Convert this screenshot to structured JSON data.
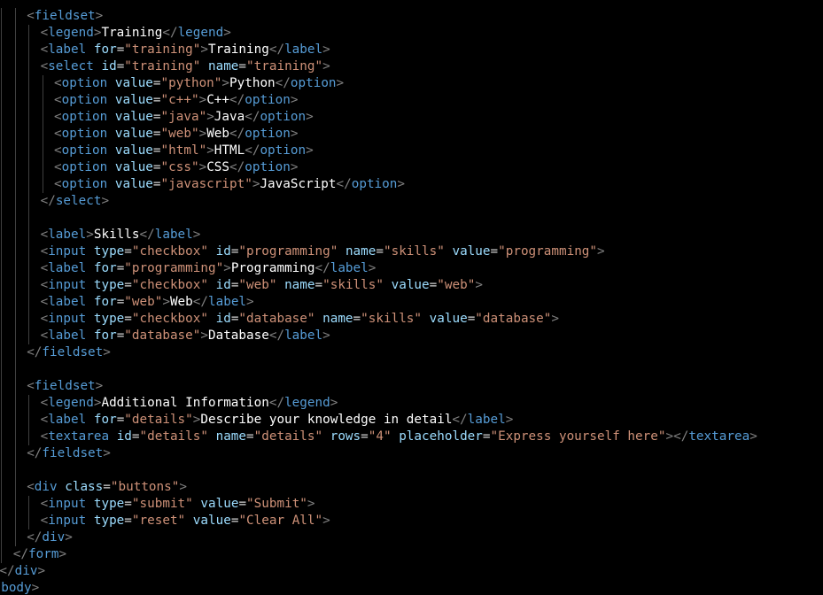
{
  "theme": {
    "background": "#000000",
    "bracket": "#808080",
    "tag": "#569cd6",
    "attribute": "#9cdcfe",
    "string": "#ce9178",
    "text": "#ffffff",
    "indent_guide": "#404040"
  },
  "lines": [
    {
      "indent": 6,
      "tokens": [
        [
          "b",
          "<"
        ],
        [
          "t",
          "fieldset"
        ],
        [
          "b",
          ">"
        ]
      ]
    },
    {
      "indent": 8,
      "tokens": [
        [
          "b",
          "<"
        ],
        [
          "t",
          "legend"
        ],
        [
          "b",
          ">"
        ],
        [
          "x",
          "Training"
        ],
        [
          "b",
          "</"
        ],
        [
          "t",
          "legend"
        ],
        [
          "b",
          ">"
        ]
      ]
    },
    {
      "indent": 8,
      "tokens": [
        [
          "b",
          "<"
        ],
        [
          "t",
          "label"
        ],
        [
          "x",
          " "
        ],
        [
          "a",
          "for"
        ],
        [
          "e",
          "="
        ],
        [
          "s",
          "\"training\""
        ],
        [
          "b",
          ">"
        ],
        [
          "x",
          "Training"
        ],
        [
          "b",
          "</"
        ],
        [
          "t",
          "label"
        ],
        [
          "b",
          ">"
        ]
      ]
    },
    {
      "indent": 8,
      "tokens": [
        [
          "b",
          "<"
        ],
        [
          "t",
          "select"
        ],
        [
          "x",
          " "
        ],
        [
          "a",
          "id"
        ],
        [
          "e",
          "="
        ],
        [
          "s",
          "\"training\""
        ],
        [
          "x",
          " "
        ],
        [
          "a",
          "name"
        ],
        [
          "e",
          "="
        ],
        [
          "s",
          "\"training\""
        ],
        [
          "b",
          ">"
        ]
      ]
    },
    {
      "indent": 10,
      "tokens": [
        [
          "b",
          "<"
        ],
        [
          "t",
          "option"
        ],
        [
          "x",
          " "
        ],
        [
          "a",
          "value"
        ],
        [
          "e",
          "="
        ],
        [
          "s",
          "\"python\""
        ],
        [
          "b",
          ">"
        ],
        [
          "x",
          "Python"
        ],
        [
          "b",
          "</"
        ],
        [
          "t",
          "option"
        ],
        [
          "b",
          ">"
        ]
      ]
    },
    {
      "indent": 10,
      "tokens": [
        [
          "b",
          "<"
        ],
        [
          "t",
          "option"
        ],
        [
          "x",
          " "
        ],
        [
          "a",
          "value"
        ],
        [
          "e",
          "="
        ],
        [
          "s",
          "\"c++\""
        ],
        [
          "b",
          ">"
        ],
        [
          "x",
          "C++"
        ],
        [
          "b",
          "</"
        ],
        [
          "t",
          "option"
        ],
        [
          "b",
          ">"
        ]
      ]
    },
    {
      "indent": 10,
      "tokens": [
        [
          "b",
          "<"
        ],
        [
          "t",
          "option"
        ],
        [
          "x",
          " "
        ],
        [
          "a",
          "value"
        ],
        [
          "e",
          "="
        ],
        [
          "s",
          "\"java\""
        ],
        [
          "b",
          ">"
        ],
        [
          "x",
          "Java"
        ],
        [
          "b",
          "</"
        ],
        [
          "t",
          "option"
        ],
        [
          "b",
          ">"
        ]
      ]
    },
    {
      "indent": 10,
      "tokens": [
        [
          "b",
          "<"
        ],
        [
          "t",
          "option"
        ],
        [
          "x",
          " "
        ],
        [
          "a",
          "value"
        ],
        [
          "e",
          "="
        ],
        [
          "s",
          "\"web\""
        ],
        [
          "b",
          ">"
        ],
        [
          "x",
          "Web"
        ],
        [
          "b",
          "</"
        ],
        [
          "t",
          "option"
        ],
        [
          "b",
          ">"
        ]
      ]
    },
    {
      "indent": 10,
      "tokens": [
        [
          "b",
          "<"
        ],
        [
          "t",
          "option"
        ],
        [
          "x",
          " "
        ],
        [
          "a",
          "value"
        ],
        [
          "e",
          "="
        ],
        [
          "s",
          "\"html\""
        ],
        [
          "b",
          ">"
        ],
        [
          "x",
          "HTML"
        ],
        [
          "b",
          "</"
        ],
        [
          "t",
          "option"
        ],
        [
          "b",
          ">"
        ]
      ]
    },
    {
      "indent": 10,
      "tokens": [
        [
          "b",
          "<"
        ],
        [
          "t",
          "option"
        ],
        [
          "x",
          " "
        ],
        [
          "a",
          "value"
        ],
        [
          "e",
          "="
        ],
        [
          "s",
          "\"css\""
        ],
        [
          "b",
          ">"
        ],
        [
          "x",
          "CSS"
        ],
        [
          "b",
          "</"
        ],
        [
          "t",
          "option"
        ],
        [
          "b",
          ">"
        ]
      ]
    },
    {
      "indent": 10,
      "tokens": [
        [
          "b",
          "<"
        ],
        [
          "t",
          "option"
        ],
        [
          "x",
          " "
        ],
        [
          "a",
          "value"
        ],
        [
          "e",
          "="
        ],
        [
          "s",
          "\"javascript\""
        ],
        [
          "b",
          ">"
        ],
        [
          "x",
          "JavaScript"
        ],
        [
          "b",
          "</"
        ],
        [
          "t",
          "option"
        ],
        [
          "b",
          ">"
        ]
      ]
    },
    {
      "indent": 8,
      "tokens": [
        [
          "b",
          "</"
        ],
        [
          "t",
          "select"
        ],
        [
          "b",
          ">"
        ]
      ]
    },
    {
      "indent": 0,
      "tokens": []
    },
    {
      "indent": 8,
      "tokens": [
        [
          "b",
          "<"
        ],
        [
          "t",
          "label"
        ],
        [
          "b",
          ">"
        ],
        [
          "x",
          "Skills"
        ],
        [
          "b",
          "</"
        ],
        [
          "t",
          "label"
        ],
        [
          "b",
          ">"
        ]
      ]
    },
    {
      "indent": 8,
      "tokens": [
        [
          "b",
          "<"
        ],
        [
          "t",
          "input"
        ],
        [
          "x",
          " "
        ],
        [
          "a",
          "type"
        ],
        [
          "e",
          "="
        ],
        [
          "s",
          "\"checkbox\""
        ],
        [
          "x",
          " "
        ],
        [
          "a",
          "id"
        ],
        [
          "e",
          "="
        ],
        [
          "s",
          "\"programming\""
        ],
        [
          "x",
          " "
        ],
        [
          "a",
          "name"
        ],
        [
          "e",
          "="
        ],
        [
          "s",
          "\"skills\""
        ],
        [
          "x",
          " "
        ],
        [
          "a",
          "value"
        ],
        [
          "e",
          "="
        ],
        [
          "s",
          "\"programming\""
        ],
        [
          "b",
          ">"
        ]
      ]
    },
    {
      "indent": 8,
      "tokens": [
        [
          "b",
          "<"
        ],
        [
          "t",
          "label"
        ],
        [
          "x",
          " "
        ],
        [
          "a",
          "for"
        ],
        [
          "e",
          "="
        ],
        [
          "s",
          "\"programming\""
        ],
        [
          "b",
          ">"
        ],
        [
          "x",
          "Programming"
        ],
        [
          "b",
          "</"
        ],
        [
          "t",
          "label"
        ],
        [
          "b",
          ">"
        ]
      ]
    },
    {
      "indent": 8,
      "tokens": [
        [
          "b",
          "<"
        ],
        [
          "t",
          "input"
        ],
        [
          "x",
          " "
        ],
        [
          "a",
          "type"
        ],
        [
          "e",
          "="
        ],
        [
          "s",
          "\"checkbox\""
        ],
        [
          "x",
          " "
        ],
        [
          "a",
          "id"
        ],
        [
          "e",
          "="
        ],
        [
          "s",
          "\"web\""
        ],
        [
          "x",
          " "
        ],
        [
          "a",
          "name"
        ],
        [
          "e",
          "="
        ],
        [
          "s",
          "\"skills\""
        ],
        [
          "x",
          " "
        ],
        [
          "a",
          "value"
        ],
        [
          "e",
          "="
        ],
        [
          "s",
          "\"web\""
        ],
        [
          "b",
          ">"
        ]
      ]
    },
    {
      "indent": 8,
      "tokens": [
        [
          "b",
          "<"
        ],
        [
          "t",
          "label"
        ],
        [
          "x",
          " "
        ],
        [
          "a",
          "for"
        ],
        [
          "e",
          "="
        ],
        [
          "s",
          "\"web\""
        ],
        [
          "b",
          ">"
        ],
        [
          "x",
          "Web"
        ],
        [
          "b",
          "</"
        ],
        [
          "t",
          "label"
        ],
        [
          "b",
          ">"
        ]
      ]
    },
    {
      "indent": 8,
      "tokens": [
        [
          "b",
          "<"
        ],
        [
          "t",
          "input"
        ],
        [
          "x",
          " "
        ],
        [
          "a",
          "type"
        ],
        [
          "e",
          "="
        ],
        [
          "s",
          "\"checkbox\""
        ],
        [
          "x",
          " "
        ],
        [
          "a",
          "id"
        ],
        [
          "e",
          "="
        ],
        [
          "s",
          "\"database\""
        ],
        [
          "x",
          " "
        ],
        [
          "a",
          "name"
        ],
        [
          "e",
          "="
        ],
        [
          "s",
          "\"skills\""
        ],
        [
          "x",
          " "
        ],
        [
          "a",
          "value"
        ],
        [
          "e",
          "="
        ],
        [
          "s",
          "\"database\""
        ],
        [
          "b",
          ">"
        ]
      ]
    },
    {
      "indent": 8,
      "tokens": [
        [
          "b",
          "<"
        ],
        [
          "t",
          "label"
        ],
        [
          "x",
          " "
        ],
        [
          "a",
          "for"
        ],
        [
          "e",
          "="
        ],
        [
          "s",
          "\"database\""
        ],
        [
          "b",
          ">"
        ],
        [
          "x",
          "Database"
        ],
        [
          "b",
          "</"
        ],
        [
          "t",
          "label"
        ],
        [
          "b",
          ">"
        ]
      ]
    },
    {
      "indent": 6,
      "tokens": [
        [
          "b",
          "</"
        ],
        [
          "t",
          "fieldset"
        ],
        [
          "b",
          ">"
        ]
      ]
    },
    {
      "indent": 0,
      "tokens": []
    },
    {
      "indent": 6,
      "tokens": [
        [
          "b",
          "<"
        ],
        [
          "t",
          "fieldset"
        ],
        [
          "b",
          ">"
        ]
      ]
    },
    {
      "indent": 8,
      "tokens": [
        [
          "b",
          "<"
        ],
        [
          "t",
          "legend"
        ],
        [
          "b",
          ">"
        ],
        [
          "x",
          "Additional Information"
        ],
        [
          "b",
          "</"
        ],
        [
          "t",
          "legend"
        ],
        [
          "b",
          ">"
        ]
      ]
    },
    {
      "indent": 8,
      "tokens": [
        [
          "b",
          "<"
        ],
        [
          "t",
          "label"
        ],
        [
          "x",
          " "
        ],
        [
          "a",
          "for"
        ],
        [
          "e",
          "="
        ],
        [
          "s",
          "\"details\""
        ],
        [
          "b",
          ">"
        ],
        [
          "x",
          "Describe your knowledge in detail"
        ],
        [
          "b",
          "</"
        ],
        [
          "t",
          "label"
        ],
        [
          "b",
          ">"
        ]
      ]
    },
    {
      "indent": 8,
      "tokens": [
        [
          "b",
          "<"
        ],
        [
          "t",
          "textarea"
        ],
        [
          "x",
          " "
        ],
        [
          "a",
          "id"
        ],
        [
          "e",
          "="
        ],
        [
          "s",
          "\"details\""
        ],
        [
          "x",
          " "
        ],
        [
          "a",
          "name"
        ],
        [
          "e",
          "="
        ],
        [
          "s",
          "\"details\""
        ],
        [
          "x",
          " "
        ],
        [
          "a",
          "rows"
        ],
        [
          "e",
          "="
        ],
        [
          "s",
          "\"4\""
        ],
        [
          "x",
          " "
        ],
        [
          "a",
          "placeholder"
        ],
        [
          "e",
          "="
        ],
        [
          "s",
          "\"Express yourself here\""
        ],
        [
          "b",
          "></"
        ],
        [
          "t",
          "textarea"
        ],
        [
          "b",
          ">"
        ]
      ]
    },
    {
      "indent": 6,
      "tokens": [
        [
          "b",
          "</"
        ],
        [
          "t",
          "fieldset"
        ],
        [
          "b",
          ">"
        ]
      ]
    },
    {
      "indent": 0,
      "tokens": []
    },
    {
      "indent": 6,
      "tokens": [
        [
          "b",
          "<"
        ],
        [
          "t",
          "div"
        ],
        [
          "x",
          " "
        ],
        [
          "a",
          "class"
        ],
        [
          "e",
          "="
        ],
        [
          "s",
          "\"buttons\""
        ],
        [
          "b",
          ">"
        ]
      ]
    },
    {
      "indent": 8,
      "tokens": [
        [
          "b",
          "<"
        ],
        [
          "t",
          "input"
        ],
        [
          "x",
          " "
        ],
        [
          "a",
          "type"
        ],
        [
          "e",
          "="
        ],
        [
          "s",
          "\"submit\""
        ],
        [
          "x",
          " "
        ],
        [
          "a",
          "value"
        ],
        [
          "e",
          "="
        ],
        [
          "s",
          "\"Submit\""
        ],
        [
          "b",
          ">"
        ]
      ]
    },
    {
      "indent": 8,
      "tokens": [
        [
          "b",
          "<"
        ],
        [
          "t",
          "input"
        ],
        [
          "x",
          " "
        ],
        [
          "a",
          "type"
        ],
        [
          "e",
          "="
        ],
        [
          "s",
          "\"reset\""
        ],
        [
          "x",
          " "
        ],
        [
          "a",
          "value"
        ],
        [
          "e",
          "="
        ],
        [
          "s",
          "\"Clear All\""
        ],
        [
          "b",
          ">"
        ]
      ]
    },
    {
      "indent": 6,
      "tokens": [
        [
          "b",
          "</"
        ],
        [
          "t",
          "div"
        ],
        [
          "b",
          ">"
        ]
      ]
    },
    {
      "indent": 4,
      "tokens": [
        [
          "b",
          "</"
        ],
        [
          "t",
          "form"
        ],
        [
          "b",
          ">"
        ]
      ]
    },
    {
      "indent": 2,
      "tokens": [
        [
          "b",
          "</"
        ],
        [
          "t",
          "div"
        ],
        [
          "b",
          ">"
        ]
      ]
    },
    {
      "indent": 0,
      "tokens": [
        [
          "b",
          "</"
        ],
        [
          "t",
          "body"
        ],
        [
          "b",
          ">"
        ]
      ]
    }
  ]
}
